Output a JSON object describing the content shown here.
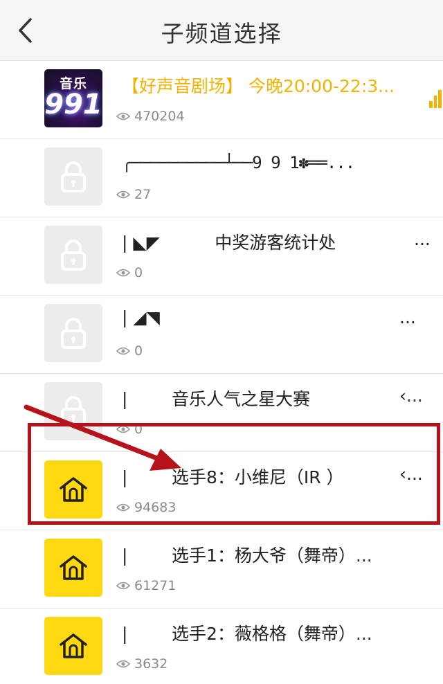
{
  "header": {
    "title": "子频道选择",
    "back_icon": "chevron-left-icon"
  },
  "channels": [
    {
      "title": "【好声音剧场】 今晚20:00-22:3...",
      "views": "470204",
      "thumb": "channel-logo",
      "logo_top": "音乐",
      "logo_num": "991",
      "playing": true
    },
    {
      "title": "╭──────────┴──9 9 1✽══...",
      "views": "27",
      "thumb": "lock-icon"
    },
    {
      "title": "| ◣◤          中奖游客统计处",
      "more": "...",
      "views": "0",
      "thumb": "lock-icon"
    },
    {
      "title": "| ◢◥",
      "more": "...",
      "views": "0",
      "thumb": "lock-icon"
    },
    {
      "title": "|        音乐人气之星大赛",
      "more": "‹...",
      "views": "0",
      "thumb": "lock-icon"
    },
    {
      "title": "|        选手8：小维尼（IR ）",
      "more": "‹...",
      "views": "94683",
      "thumb": "house-icon"
    },
    {
      "title": "|        选手1：杨大爷（舞帝）...",
      "views": "61271",
      "thumb": "house-icon"
    },
    {
      "title": "|        选手2：薇格格（舞帝）...",
      "views": "3632",
      "thumb": "house-icon"
    }
  ],
  "colors": {
    "highlight_title": "#f2b300",
    "annotation_red": "#b5121b",
    "house_bg": "#ffd812",
    "lock_bg": "#ececec"
  }
}
